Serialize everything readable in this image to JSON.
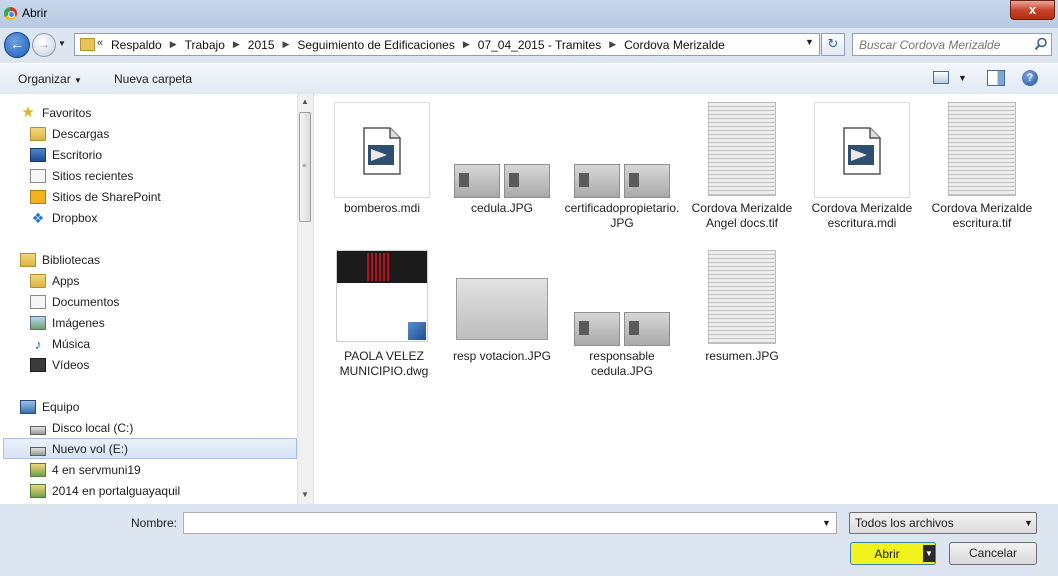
{
  "window": {
    "title": "Abrir",
    "close_glyph": "x"
  },
  "nav": {
    "back_glyph": "←",
    "forward_glyph": "→",
    "addr_chevrons": "«",
    "refresh_glyph": "↻"
  },
  "breadcrumbs": [
    "Respaldo",
    "Trabajo",
    "2015",
    "Seguimiento de Edificaciones",
    "07_04_2015 - Tramites",
    "Cordova Merizalde"
  ],
  "search": {
    "placeholder": "Buscar Cordova Merizalde",
    "value": ""
  },
  "toolbar": {
    "organize_label": "Organizar",
    "new_folder_label": "Nueva carpeta",
    "help_glyph": "?"
  },
  "navpane": {
    "favorites": {
      "header": "Favoritos",
      "items": [
        "Descargas",
        "Escritorio",
        "Sitios recientes",
        "Sitios de SharePoint",
        "Dropbox"
      ]
    },
    "libraries": {
      "header": "Bibliotecas",
      "items": [
        "Apps",
        "Documentos",
        "Imágenes",
        "Música",
        "Vídeos"
      ]
    },
    "computer": {
      "header": "Equipo",
      "items": [
        "Disco local (C:)",
        "Nuevo vol (E:)",
        "4 en servmuni19",
        "2014 en portalguayaquil"
      ],
      "selected": "Nuevo vol (E:)"
    }
  },
  "files": [
    {
      "name": "bomberos.mdi",
      "thumb": "mdi-icon"
    },
    {
      "name": "cedula.JPG",
      "thumb": "id-cards"
    },
    {
      "name": "certificadopropietario.JPG",
      "thumb": "id-cards"
    },
    {
      "name": "Cordova Merizalde Angel docs.tif",
      "thumb": "scanned-document"
    },
    {
      "name": "Cordova Merizalde escritura.mdi",
      "thumb": "mdi-icon"
    },
    {
      "name": "Cordova Merizalde escritura.tif",
      "thumb": "scanned-document"
    },
    {
      "name": "PAOLA VELEZ MUNICIPIO.dwg",
      "thumb": "dwg-drawing"
    },
    {
      "name": "resp votacion.JPG",
      "thumb": "id-card"
    },
    {
      "name": "responsable cedula.JPG",
      "thumb": "id-cards"
    },
    {
      "name": "resumen.JPG",
      "thumb": "scanned-document"
    }
  ],
  "bottom": {
    "filename_label": "Nombre:",
    "filename_value": "",
    "filetype_value": "Todos los archivos",
    "open_label": "Abrir",
    "cancel_label": "Cancelar",
    "open_highlight_color": "#f2f21c"
  }
}
